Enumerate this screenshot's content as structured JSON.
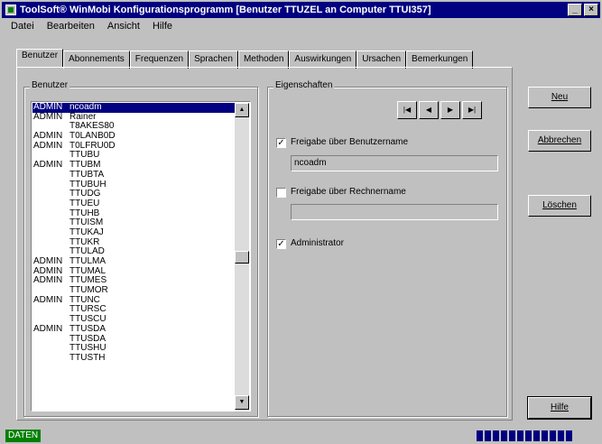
{
  "window": {
    "title": "ToolSoft® WinMobi Konfigurationsprogramm [Benutzer TTUZEL an Computer TTUI357]"
  },
  "menu": [
    "Datei",
    "Bearbeiten",
    "Ansicht",
    "Hilfe"
  ],
  "tabs": [
    "Benutzer",
    "Abonnements",
    "Frequenzen",
    "Sprachen",
    "Methoden",
    "Auswirkungen",
    "Ursachen",
    "Bemerkungen"
  ],
  "users_group": {
    "legend": "Benutzer",
    "rows": [
      {
        "role": "ADMIN",
        "name": "ncoadm",
        "selected": true
      },
      {
        "role": "ADMIN",
        "name": "Rainer"
      },
      {
        "role": "",
        "name": "T8AKES80"
      },
      {
        "role": "ADMIN",
        "name": "T0LANB0D"
      },
      {
        "role": "ADMIN",
        "name": "T0LFRU0D"
      },
      {
        "role": "",
        "name": "TTUBU"
      },
      {
        "role": "ADMIN",
        "name": "TTUBM"
      },
      {
        "role": "",
        "name": "TTUBTA"
      },
      {
        "role": "",
        "name": "TTUBUH"
      },
      {
        "role": "",
        "name": "TTUDG"
      },
      {
        "role": "",
        "name": "TTUEU"
      },
      {
        "role": "",
        "name": "TTUHB"
      },
      {
        "role": "",
        "name": "TTUISM"
      },
      {
        "role": "",
        "name": "TTUKAJ"
      },
      {
        "role": "",
        "name": "TTUKR"
      },
      {
        "role": "",
        "name": "TTULAD"
      },
      {
        "role": "ADMIN",
        "name": "TTULMA"
      },
      {
        "role": "ADMIN",
        "name": "TTUMAL"
      },
      {
        "role": "ADMIN",
        "name": "TTUMES"
      },
      {
        "role": "",
        "name": "TTUMOR"
      },
      {
        "role": "ADMIN",
        "name": "TTUNC"
      },
      {
        "role": "",
        "name": "TTURSC"
      },
      {
        "role": "",
        "name": "TTUSCU"
      },
      {
        "role": "ADMIN",
        "name": "TTUSDA"
      },
      {
        "role": "",
        "name": "TTUSDA"
      },
      {
        "role": "",
        "name": "TTUSHU"
      },
      {
        "role": "",
        "name": "TTUSTH"
      }
    ]
  },
  "properties_group": {
    "legend": "Eigenschaften",
    "nav_icons": [
      "first-record-icon",
      "prev-record-icon",
      "next-record-icon",
      "last-record-icon"
    ],
    "share_by_username": {
      "label": "Freigabe über Benutzername",
      "checked": true,
      "value": "ncoadm"
    },
    "share_by_computer": {
      "label": "Freigabe über Rechnername",
      "checked": false,
      "value": ""
    },
    "administrator": {
      "label": "Administrator",
      "checked": true
    }
  },
  "buttons": {
    "new": "Neu",
    "cancel": "Abbrechen",
    "delete": "Löschen",
    "help": "Hilfe"
  },
  "status": {
    "text": "DATEN",
    "progress_blocks": 12
  }
}
